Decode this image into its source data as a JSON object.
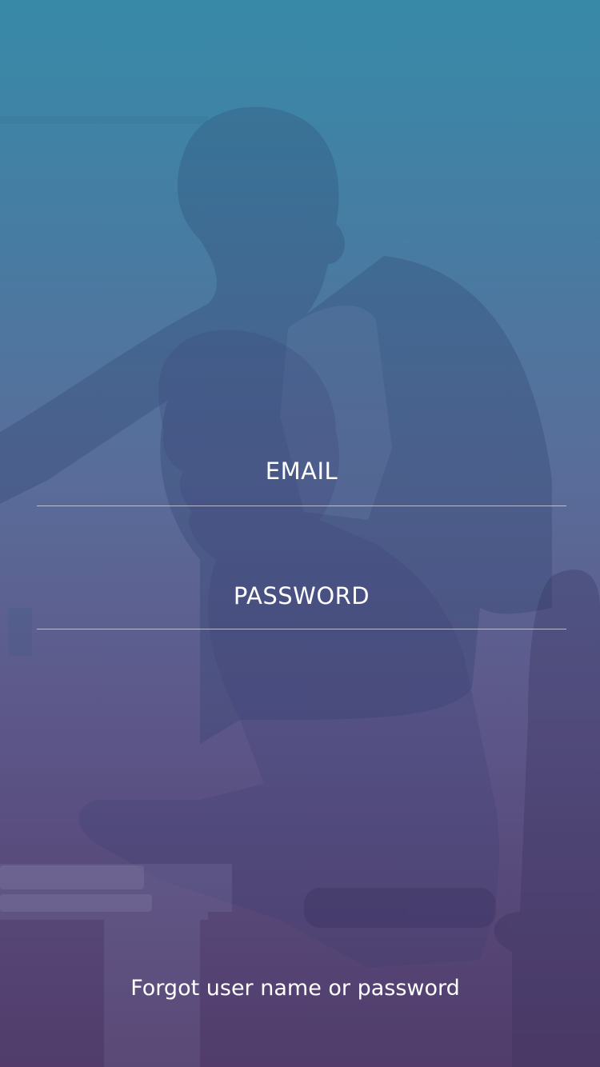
{
  "login": {
    "email_placeholder": "EMAIL",
    "password_placeholder": "PASSWORD",
    "forgot_link": "Forgot user name or password"
  },
  "colors": {
    "gradient_top": "#3a88a8",
    "gradient_bottom": "#533f6f",
    "text": "#ffffff",
    "underline": "#dcdceb"
  }
}
